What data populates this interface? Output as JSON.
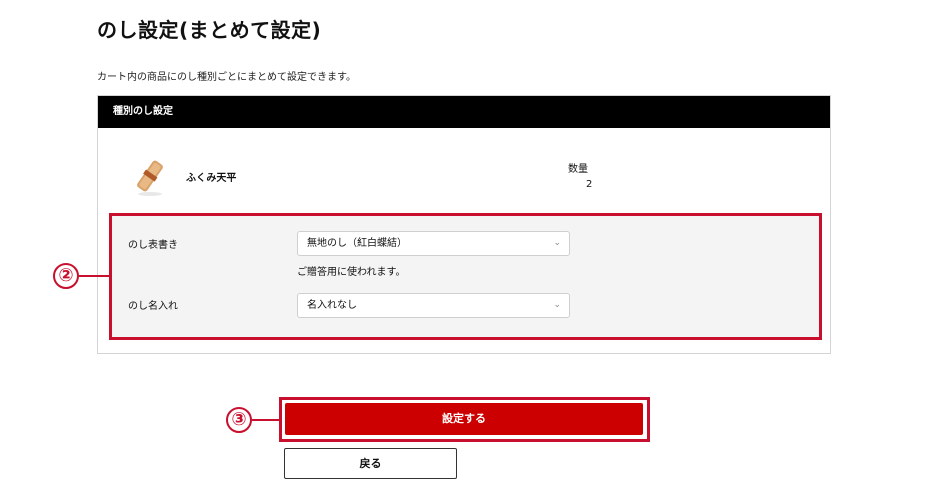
{
  "page": {
    "title": "のし設定(まとめて設定)",
    "description": "カート内の商品にのし種別ごとにまとめて設定できます。"
  },
  "panel": {
    "header": "種別のし設定",
    "product": {
      "name": "ふくみ天平",
      "quantity_label": "数量",
      "quantity_value": "2"
    },
    "form": {
      "noshi_label": "のし表書き",
      "noshi_selected": "無地のし（紅白蝶結）",
      "noshi_help": "ご贈答用に使われます。",
      "name_label": "のし名入れ",
      "name_selected": "名入れなし"
    }
  },
  "callouts": {
    "form": "②",
    "submit": "③"
  },
  "actions": {
    "submit_label": "設定する",
    "back_label": "戻る"
  },
  "colors": {
    "accent": "#cc0000",
    "highlight": "#c8102e",
    "header_bg": "#000000",
    "form_bg": "#f4f4f4"
  },
  "icons": {
    "select_chevron": "chevron-down-icon"
  }
}
